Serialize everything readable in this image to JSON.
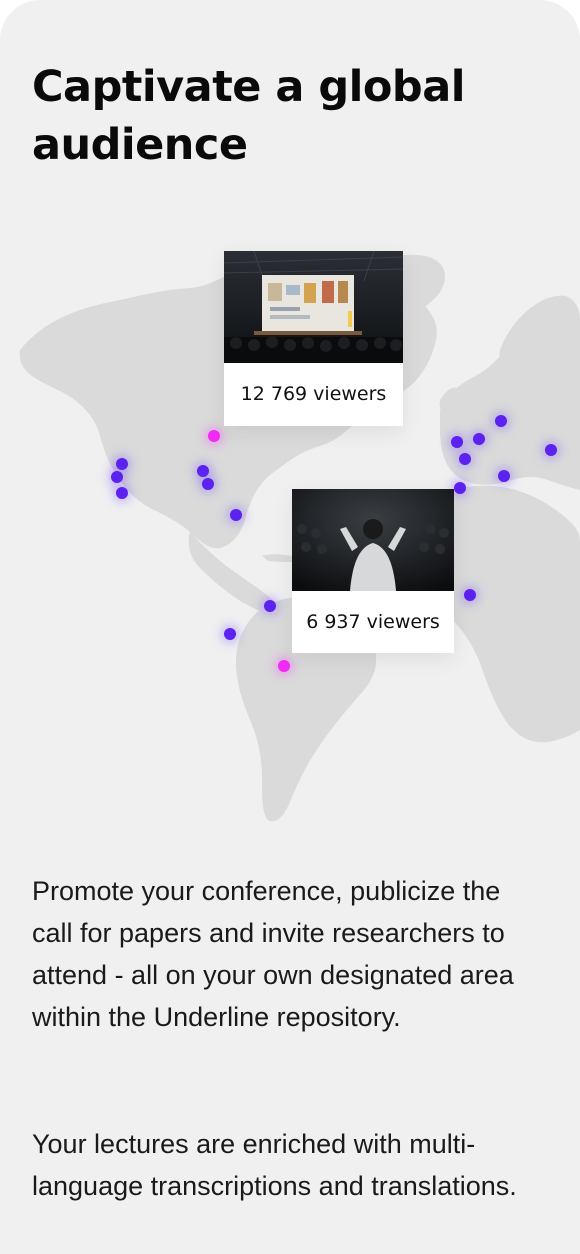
{
  "heading": "Captivate a global audience",
  "cards": [
    {
      "viewers": "12 769 viewers",
      "thumbnail": "conference-hall-screen-image"
    },
    {
      "viewers": "6 937 viewers",
      "thumbnail": "speaker-on-stage-image"
    }
  ],
  "paragraphs": [
    "Promote your conference, publicize the call for papers and invite researchers to attend - all on your own designated area within the Underline repository.",
    "Your lectures are enriched with multi-language transcriptions and translations."
  ],
  "colors": {
    "background": "#f0f0f0",
    "map_land": "#d9d9d9",
    "dot_purple": "#5b22f0",
    "dot_pink": "#f02bf5",
    "text": "#1a1a1a"
  }
}
